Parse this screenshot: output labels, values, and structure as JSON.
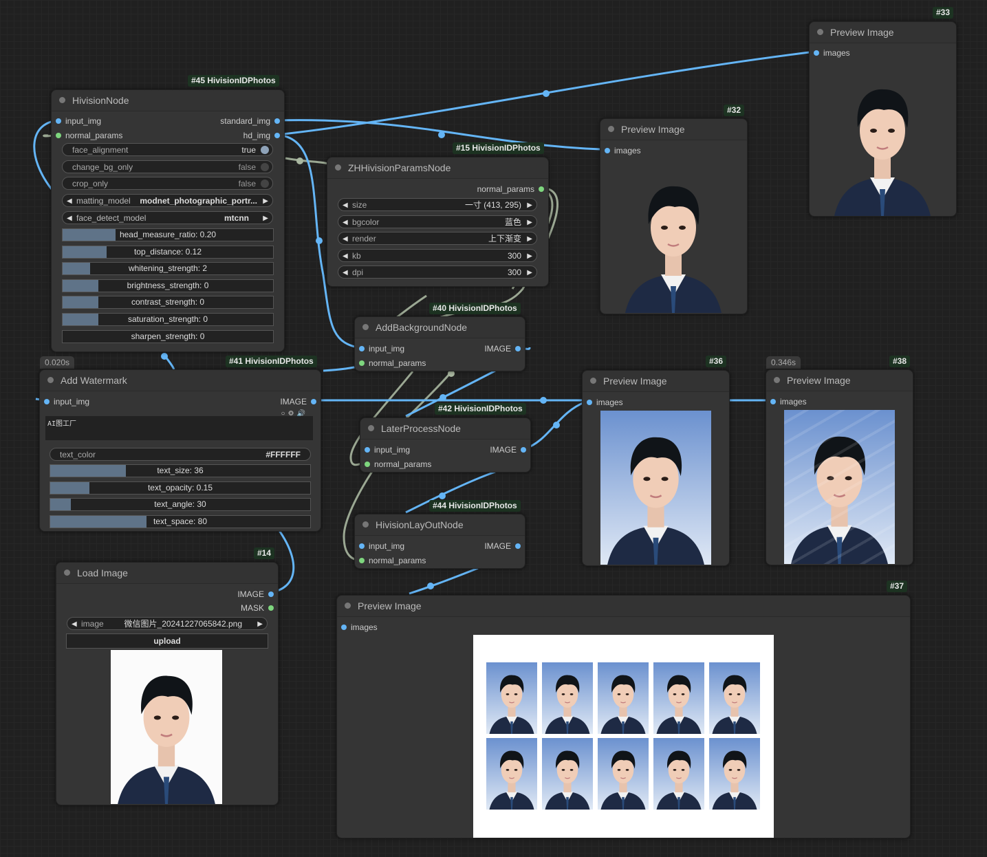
{
  "nodes": {
    "hivision": {
      "badge": "#45 HivisionIDPhotos",
      "title": "HivisionNode",
      "inputs": [
        "input_img",
        "normal_params"
      ],
      "outputs": [
        "standard_img",
        "hd_img"
      ],
      "toggles": [
        {
          "label": "face_alignment",
          "value": "true"
        },
        {
          "label": "change_bg_only",
          "value": "false"
        },
        {
          "label": "crop_only",
          "value": "false"
        }
      ],
      "combos": [
        {
          "label": "matting_model",
          "value": "modnet_photographic_portr..."
        },
        {
          "label": "face_detect_model",
          "value": "mtcnn"
        }
      ],
      "sliders": [
        {
          "label": "head_measure_ratio: 0.20",
          "fill": 0.25
        },
        {
          "label": "top_distance: 0.12",
          "fill": 0.21
        },
        {
          "label": "whitening_strength: 2",
          "fill": 0.13
        },
        {
          "label": "brightness_strength: 0",
          "fill": 0.17
        },
        {
          "label": "contrast_strength: 0",
          "fill": 0.17
        },
        {
          "label": "saturation_strength: 0",
          "fill": 0.17
        },
        {
          "label": "sharpen_strength: 0",
          "fill": 0
        }
      ]
    },
    "params": {
      "badge": "#15 HivisionIDPhotos",
      "title": "ZHHivisionParamsNode",
      "output": "normal_params",
      "combos": [
        {
          "label": "size",
          "value": "一寸 (413, 295)"
        },
        {
          "label": "bgcolor",
          "value": "蓝色"
        },
        {
          "label": "render",
          "value": "上下渐变"
        },
        {
          "label": "kb",
          "value": "300"
        },
        {
          "label": "dpi",
          "value": "300"
        }
      ]
    },
    "addbg": {
      "badge": "#40 HivisionIDPhotos",
      "title": "AddBackgroundNode",
      "inputs": [
        "input_img",
        "normal_params"
      ],
      "output": "IMAGE"
    },
    "watermark": {
      "timing": "0.020s",
      "badge": "#41 HivisionIDPhotos",
      "title": "Add Watermark",
      "input": "input_img",
      "output": "IMAGE",
      "text": "AI图工厂",
      "color_label": "text_color",
      "color_value": "#FFFFFF",
      "sliders": [
        {
          "label": "text_size: 36",
          "fill": 0.29
        },
        {
          "label": "text_opacity: 0.15",
          "fill": 0.15
        },
        {
          "label": "text_angle: 30",
          "fill": 0.08
        },
        {
          "label": "text_space: 80",
          "fill": 0.37
        }
      ]
    },
    "later": {
      "badge": "#42 HivisionIDPhotos",
      "title": "LaterProcessNode",
      "inputs": [
        "input_img",
        "normal_params"
      ],
      "output": "IMAGE"
    },
    "layout": {
      "badge": "#44 HivisionIDPhotos",
      "title": "HivisionLayOutNode",
      "inputs": [
        "input_img",
        "normal_params"
      ],
      "output": "IMAGE"
    },
    "load": {
      "badge": "#14",
      "title": "Load Image",
      "outputs": [
        "IMAGE",
        "MASK"
      ],
      "image_label": "image",
      "image_value": "微信图片_20241227065842.png",
      "upload": "upload"
    },
    "p33": {
      "badge": "#33",
      "title": "Preview Image",
      "input": "images"
    },
    "p32": {
      "badge": "#32",
      "title": "Preview Image",
      "input": "images"
    },
    "p36": {
      "badge": "#36",
      "title": "Preview Image",
      "input": "images"
    },
    "p38": {
      "badge": "#38",
      "timing": "0.346s",
      "title": "Preview Image",
      "input": "images"
    },
    "p37": {
      "badge": "#37",
      "title": "Preview Image",
      "input": "images"
    }
  },
  "colors": {
    "image_link": "#64b5f6",
    "params_link": "#7ed67e",
    "params_wire": "#a9b7a0",
    "node_bg": "#353535"
  }
}
